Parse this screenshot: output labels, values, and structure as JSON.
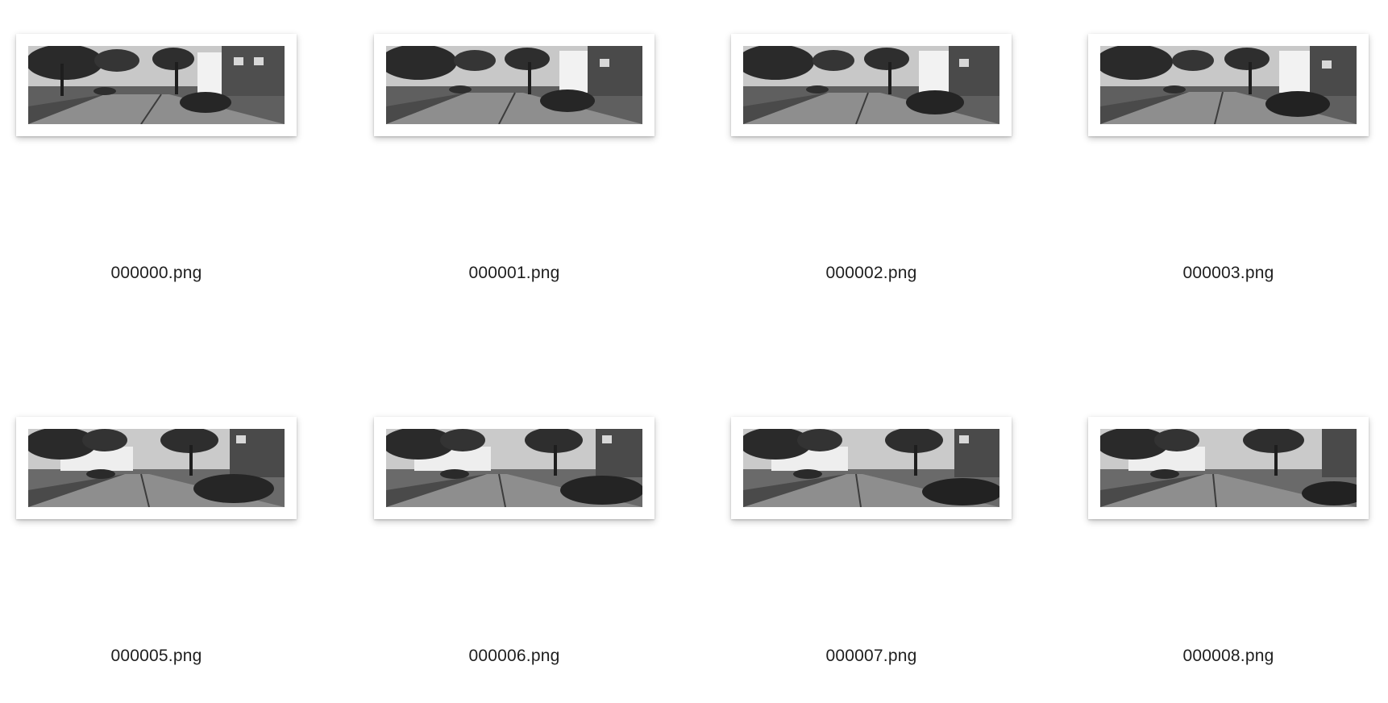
{
  "files": [
    {
      "name": "000000.png",
      "icon": "street-scene-thumbnail-icon"
    },
    {
      "name": "000001.png",
      "icon": "street-scene-thumbnail-icon"
    },
    {
      "name": "000002.png",
      "icon": "street-scene-thumbnail-icon"
    },
    {
      "name": "000003.png",
      "icon": "street-scene-thumbnail-icon"
    },
    {
      "name": "000005.png",
      "icon": "street-scene-thumbnail-icon"
    },
    {
      "name": "000006.png",
      "icon": "street-scene-thumbnail-icon"
    },
    {
      "name": "000007.png",
      "icon": "street-scene-thumbnail-icon"
    },
    {
      "name": "000008.png",
      "icon": "street-scene-thumbnail-icon"
    }
  ]
}
